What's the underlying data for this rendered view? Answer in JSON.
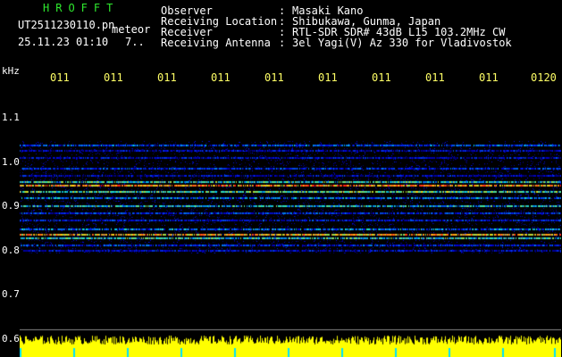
{
  "header": {
    "brand": "HROFFT",
    "filename": "UT2511230110.pn",
    "tag": "meteor",
    "datetime": "25.11.23 01:10",
    "count": "7..",
    "fields": [
      {
        "label": "Observer",
        "value": "Masaki Kano"
      },
      {
        "label": "Receiving Location",
        "value": "Shibukawa, Gunma, Japan"
      },
      {
        "label": "Receiver",
        "value": "RTL-SDR SDR# 43dB L15 103.2MHz CW"
      },
      {
        "label": "Receiving Antenna",
        "value": "3el Yagi(V) Az 330 for Vladivostok"
      }
    ],
    "separator": ":"
  },
  "axis": {
    "y_unit": "kHz",
    "y_labels": [
      "1.1",
      "1.0",
      "0.9",
      "0.8",
      "0.7",
      "0.6"
    ],
    "x_labels": [
      "011",
      "011",
      "011",
      "011",
      "011",
      "011",
      "011",
      "011",
      "011",
      "0120"
    ]
  },
  "colors": {
    "background": "#000000",
    "spectrum_low": "#000080",
    "spectrum_high": "#ff2020",
    "amplitude": "#ffff00",
    "brand": "#2ee82e"
  }
}
